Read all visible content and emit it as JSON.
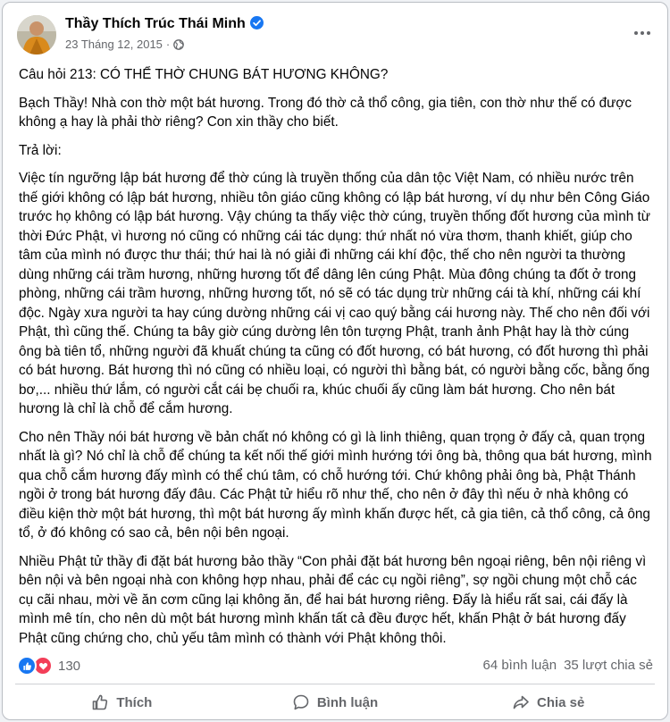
{
  "post": {
    "author": "Thầy Thích Trúc Thái Minh",
    "date": "23 Tháng 12, 2015",
    "meta_separator": "·",
    "paragraphs": [
      "Câu hỏi 213: CÓ THỂ THỜ CHUNG BÁT HƯƠNG KHÔNG?",
      "Bạch Thầy! Nhà con thờ một bát hương. Trong đó thờ cả thổ công, gia tiên, con thờ như thế có được không ạ hay là phải thờ riêng? Con xin thầy cho biết.",
      "Trả lời:",
      "Việc tín ngưỡng lập bát hương để thờ cúng là truyền thống của dân tộc Việt Nam, có nhiều nước trên thế giới không có lập bát hương, nhiều tôn giáo cũng không có lập bát hương, ví dụ như bên Công Giáo trước họ không có lập bát hương. Vậy chúng ta thấy việc thờ cúng, truyền thống đốt hương của mình từ thời Đức Phật, vì  hương nó cũng có những cái tác dụng: thứ nhất nó vừa thơm, thanh khiết, giúp cho tâm của mình nó được thư thái; thứ hai là nó giải đi những cái khí độc, thế cho nên người ta thường dùng những cái trầm hương, những hương tốt để dâng lên cúng Phật. Mùa đông chúng ta đốt ở trong phòng, những cái trầm hương, những hương tốt, nó sẽ có tác dụng trừ những cái tà khí, những cái khí độc. Ngày xưa người ta hay cúng dường những cái vị cao quý bằng cái hương này. Thế cho nên đối với Phật, thì cũng thế. Chúng ta bây giờ cúng dường lên tôn tượng Phật, tranh ảnh Phật hay là thờ cúng ông bà tiên tổ, những người đã khuất chúng ta cũng có đốt hương, có bát hương, có đốt hương thì phải có bát hương. Bát hương thì nó cũng có nhiều loại, có người thì bằng bát, có người bằng cốc, bằng ống bơ,... nhiều thứ lắm, có người cắt cái bẹ chuối ra, khúc chuối ấy cũng làm bát hương. Cho nên bát hương là chỉ là chỗ để cắm hương.",
      "Cho nên Thầy nói bát hương về bản chất nó không có gì là linh thiêng, quan trọng ở đấy cả, quan trọng nhất là gì? Nó chỉ là chỗ để chúng ta kết nối thế giới mình hướng tới ông bà, thông qua bát hương, mình qua chỗ cắm hương đấy mình có thể chú tâm, có chỗ hướng tới. Chứ không phải ông bà, Phật Thánh ngồi ở trong bát hương đấy đâu. Các Phật tử hiểu rõ như thế, cho nên ở đây thì nếu ở nhà không có điều kiện thờ một bát hương, thì một bát hương ấy mình khấn được hết, cả gia tiên, cả thổ công, cả ông tổ, ở đó không có sao cả, bên nội bên ngoại.",
      "Nhiều Phật tử thầy đi đặt bát hương bảo thầy “Con phải đặt bát hương bên ngoại riêng, bên nội riêng vì bên nội và bên ngoại nhà con không hợp nhau, phải để các cụ ngồi riêng”, sợ ngồi chung một chỗ các cụ cãi nhau, mời về ăn cơm cũng lại không ăn, để hai bát hương riêng. Đấy là hiểu rất sai, cái đấy là mình mê tín, cho nên dù một bát hương mình khấn tất cả đều được hết, khấn Phật ở bát hương đấy Phật cũng chứng cho, chủ yếu tâm mình có thành với Phật không thôi."
    ]
  },
  "stats": {
    "reactions": "130",
    "comments": "64 bình luận",
    "shares": "35 lượt chia sẻ"
  },
  "actions": {
    "like": "Thích",
    "comment": "Bình luận",
    "share": "Chia sẻ"
  },
  "icons": {
    "verified": "verified-badge-icon",
    "privacy": "globe-icon",
    "more": "more-options-icon",
    "like_reaction": "like-reaction-icon",
    "love_reaction": "love-reaction-icon",
    "like_action": "thumbs-up-icon",
    "comment_action": "comment-bubble-icon",
    "share_action": "share-arrow-icon"
  },
  "colors": {
    "brand_blue": "#1877f2",
    "love_red": "#f33e58",
    "secondary_text": "#65676b",
    "primary_text": "#050505"
  }
}
